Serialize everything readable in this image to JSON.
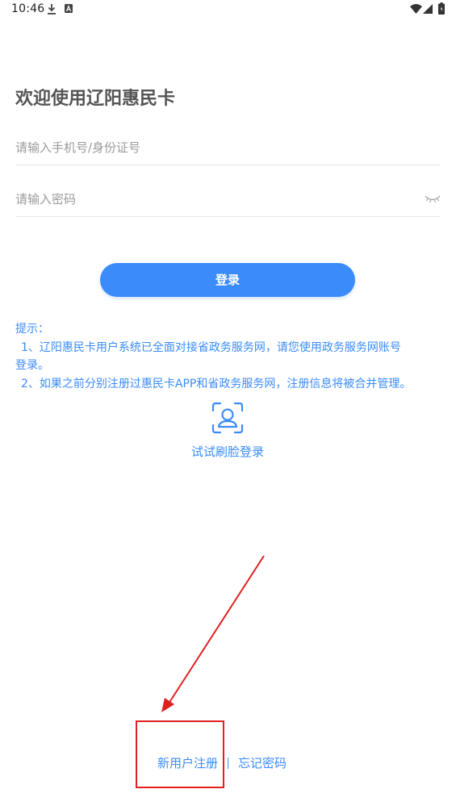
{
  "status_bar": {
    "time": "10:46",
    "icons": [
      "download-icon",
      "a-icon",
      "wifi-icon",
      "signal-icon",
      "battery-icon"
    ]
  },
  "welcome": {
    "title": "欢迎使用辽阳惠民卡"
  },
  "form": {
    "account_placeholder": "请输入手机号/身份证号",
    "account_value": "",
    "password_placeholder": "请输入密码",
    "password_value": "",
    "password_toggle_icon": "eye-closed-icon"
  },
  "login_button": {
    "label": "登录"
  },
  "tip": {
    "heading": "提示：",
    "line1": "1、辽阳惠民卡用户系统已全面对接省政务服务网，请您使用政务服务网账号",
    "line1_cont": "登录。",
    "line2": "2、如果之前分别注册过惠民卡APP和省政务服务网，注册信息将被合并管理。"
  },
  "face_login": {
    "icon": "face-recognition-icon",
    "label": "试试刷脸登录"
  },
  "footer": {
    "register_label": "新用户注册",
    "forgot_label": "忘记密码"
  },
  "colors": {
    "accent": "#3b8cfb",
    "annotation": "#e02020",
    "title": "#555555",
    "placeholder": "#9a9a9a",
    "divider": "#e8e8e8"
  }
}
